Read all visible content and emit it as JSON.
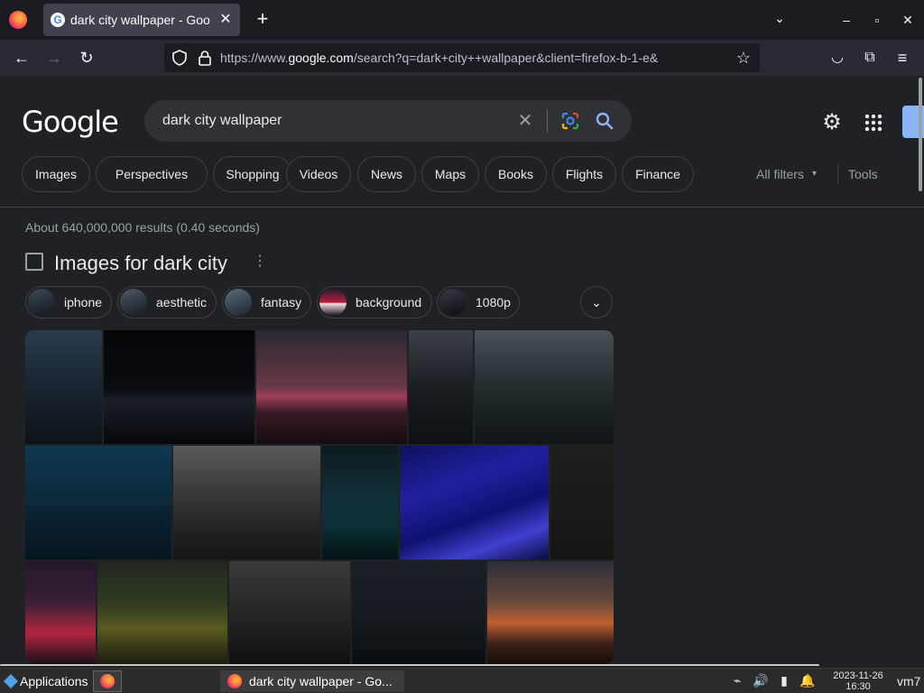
{
  "browser": {
    "tab_title": "dark city wallpaper - Goo",
    "tab_close": "✕",
    "new_tab": "+",
    "tab_list": "⌄",
    "win_min": "–",
    "win_max": "▫",
    "win_close": "✕",
    "url_prefix": "https://www.",
    "url_domain": "google.com",
    "url_suffix": "/search?q=dark+city++wallpaper&client=firefox-b-1-e&",
    "back": "←",
    "forward": "→",
    "reload": "↻",
    "bookmark_star": "☆",
    "pocket": "◡",
    "extensions": "⧉",
    "menu": "≡"
  },
  "google": {
    "logo": "Google",
    "query": "dark city wallpaper",
    "clear": "✕",
    "settings": "⚙",
    "filters": [
      "Images",
      "Perspectives",
      "Shopping",
      "Videos",
      "News",
      "Maps",
      "Books",
      "Flights",
      "Finance"
    ],
    "all_filters": "All filters",
    "all_filters_caret": "▾",
    "tools": "Tools",
    "result_stats": "About 640,000,000 results (0.40 seconds)",
    "images_heading": "Images for dark city",
    "images_more": "⋮",
    "refinements": [
      "iphone",
      "aesthetic",
      "fantasy",
      "background",
      "1080p"
    ],
    "refine_expand": "⌄"
  },
  "taskbar": {
    "applications": "Applications",
    "window_title": "dark city wallpaper - Go...",
    "date": "2023-11-26",
    "time": "16:30",
    "host": "vm7",
    "tray_network": "⌁",
    "tray_volume": "🔊",
    "tray_battery": "▮",
    "tray_bell": "🔔"
  },
  "colors": {
    "page_bg": "#202124",
    "chrome_bg": "#1c1b22",
    "accent": "#8ab4f8"
  }
}
